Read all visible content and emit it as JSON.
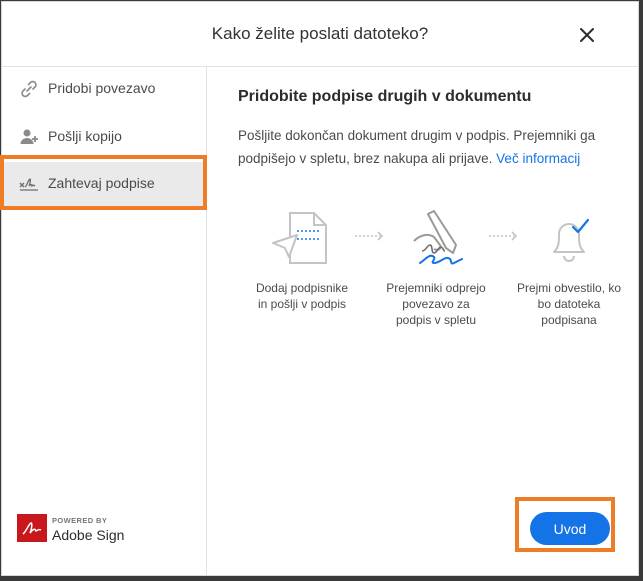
{
  "dialog": {
    "title": "Kako želite poslati datoteko?",
    "close_icon": "close-icon"
  },
  "sidebar": {
    "items": [
      {
        "label": "Pridobi povezavo",
        "icon": "link-icon",
        "selected": false
      },
      {
        "label": "Pošlji kopijo",
        "icon": "user-add-icon",
        "selected": false
      },
      {
        "label": "Zahtevaj podpise",
        "icon": "signature-icon",
        "selected": true
      }
    ]
  },
  "content": {
    "heading": "Pridobite podpise drugih v dokumentu",
    "description": "Pošljite dokončan dokument drugim v podpis. Prejemniki ga podpišejo v spletu, brez nakupa ali prijave.",
    "link_label": "Več informacij",
    "steps": [
      {
        "icon": "send-document-icon",
        "lines": [
          "Dodaj podpisnike",
          "in pošlji v podpis"
        ]
      },
      {
        "icon": "pen-signature-icon",
        "lines": [
          "Prejemniki odprejo",
          "povezavo za",
          "podpis v spletu"
        ]
      },
      {
        "icon": "bell-check-icon",
        "lines": [
          "Prejmi obvestilo, ko",
          "bo datoteka",
          "podpisana"
        ]
      }
    ]
  },
  "footer": {
    "powered_by": "POWERED BY",
    "brand": "Adobe Sign",
    "primary_button": "Uvod"
  },
  "colors": {
    "accent_blue": "#1473e6",
    "highlight_orange": "#ef7d25",
    "selected_bg": "#eaeaea",
    "adobe_red": "#c8181e"
  }
}
